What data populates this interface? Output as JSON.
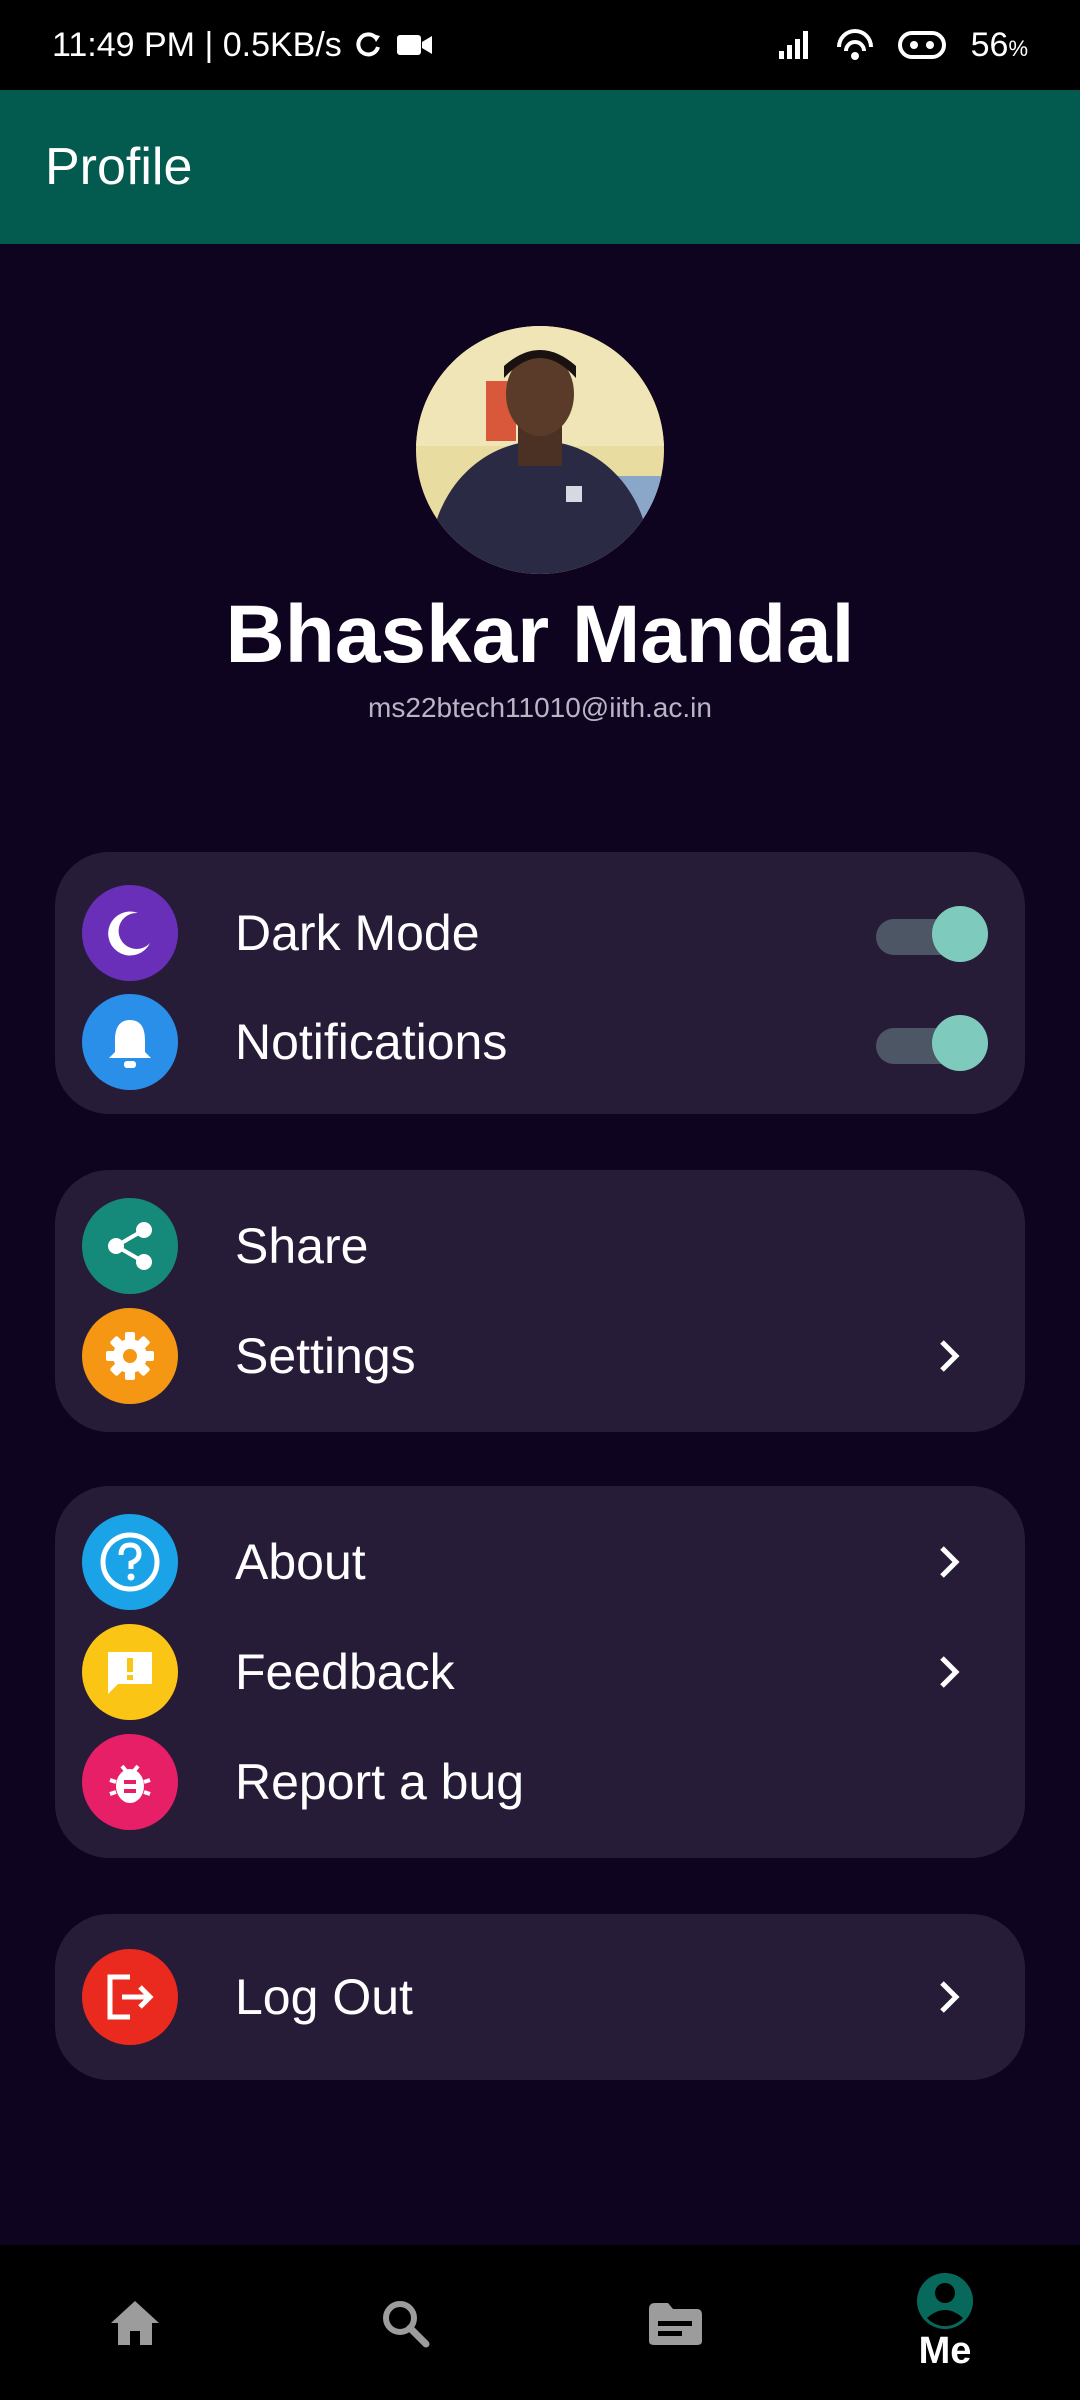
{
  "status_bar": {
    "time_speed": "11:49 PM | 0.5KB/s",
    "battery": "56",
    "battery_unit": "%"
  },
  "app_bar": {
    "title": "Profile"
  },
  "profile": {
    "name": "Bhaskar Mandal",
    "email": "ms22btech11010@iith.ac.in"
  },
  "groups": {
    "toggles": {
      "dark_mode": {
        "label": "Dark Mode",
        "icon": "moon-icon",
        "color": "#6a2fb8",
        "on": true
      },
      "notifications": {
        "label": "Notifications",
        "icon": "bell-icon",
        "color": "#2a8fe8",
        "on": true
      }
    },
    "general": {
      "share": {
        "label": "Share",
        "icon": "share-icon",
        "color": "#15897a"
      },
      "settings": {
        "label": "Settings",
        "icon": "gear-icon",
        "color": "#f59713"
      }
    },
    "support": {
      "about": {
        "label": "About",
        "icon": "help-circle-icon",
        "color": "#1aa3e6"
      },
      "feedback": {
        "label": "Feedback",
        "icon": "feedback-icon",
        "color": "#fbc515"
      },
      "report_bug": {
        "label": "Report a bug",
        "icon": "bug-icon",
        "color": "#e61f66"
      }
    },
    "account": {
      "logout": {
        "label": "Log Out",
        "icon": "logout-icon",
        "color": "#ea2a1e"
      }
    }
  },
  "bottom_nav": {
    "items": [
      {
        "icon": "home-icon"
      },
      {
        "icon": "search-icon"
      },
      {
        "icon": "documents-icon"
      },
      {
        "icon": "account-icon",
        "label": "Me",
        "active": true
      }
    ]
  },
  "colors": {
    "background": "#0f0420",
    "card": "#271c38",
    "appbar": "#035a4e",
    "toggle_thumb": "#7ecbbd"
  }
}
